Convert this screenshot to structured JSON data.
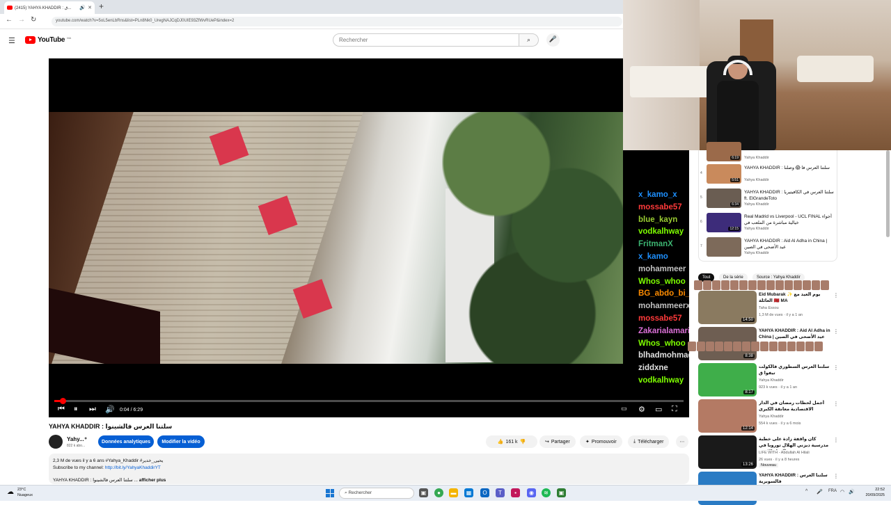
{
  "browser": {
    "tab_title": "(2415) YAHYA KHADDIR : ق...",
    "url": "youtube.com/watch?v=5oL5enLbRns&list=PLn8Nk0_UregNAJCqDJ0UIE93ZfWvRUeP&index=2"
  },
  "youtube": {
    "logo": "YouTube",
    "logo_country": "MA",
    "search_placeholder": "Rechercher"
  },
  "player": {
    "time_current": "0:04",
    "time_total": "6:29",
    "progress_fraction": 0.01
  },
  "chat": [
    {
      "user": "x_kamo_x",
      "color": "#1e90ff"
    },
    {
      "user": "mossabe57",
      "color": "#ff3a3a"
    },
    {
      "user": "blue_kayn",
      "color": "#9acd32"
    },
    {
      "user": "vodkalhway",
      "color": "#7fff00"
    },
    {
      "user": "FritmanX",
      "color": "#3cb371"
    },
    {
      "user": "x_kamo",
      "color": "#1e90ff"
    },
    {
      "user": "mohammeer",
      "color": "#c0c0c0"
    },
    {
      "user": "Whos_whoo",
      "color": "#7fff00"
    },
    {
      "user": "BG_abdo_bi_KD",
      "color": "#ff8c00"
    },
    {
      "user": "mohammeerx",
      "color": "#c0c0c0"
    },
    {
      "user": "mossabe57",
      "color": "#ff3a3a"
    },
    {
      "user": "Zakarialamari",
      "color": "#da70d6"
    },
    {
      "user": "Whos_whoo",
      "color": "#7fff00"
    },
    {
      "user": "blhadmohmad",
      "color": "#e0e0e0"
    },
    {
      "user": "ziddxne",
      "color": "#e0e0e0"
    },
    {
      "user": "vodkalhway",
      "color": "#7fff00"
    }
  ],
  "video": {
    "title": "YAHYA KHADDIR : سلتنا العرس فالشينوا",
    "channel_short": "Yahy...",
    "subscribers": "822 k abo...",
    "btn_analytics": "Données analytiques",
    "btn_edit": "Modifier la vidéo",
    "likes": "161 k",
    "share": "Partager",
    "promote": "Promouvoir",
    "download": "Télécharger",
    "desc_stats": "2,3 M de vues  il y a 6 ans  #Yahya_Khaddir #يحيى_خدير",
    "desc_subscribe": "Subscribe to my channel: ",
    "desc_link": "http://bit.ly/YahyaKhaddirYT",
    "desc_snippet": "YAHYA KHADDIR : سلتنا العرس فالشينوا ...",
    "desc_more": "afficher plus"
  },
  "playlist": [
    {
      "num": "",
      "title": "",
      "channel": "Yahya Khaddir",
      "duration": "6:19",
      "thumb": "#9b6a4a"
    },
    {
      "num": "4",
      "title": "YAHYA KHADDIR : سلتنا العرس فا 😱 وصلنا",
      "channel": "Yahya Khaddir",
      "duration": "5:51",
      "thumb": "#c98a5c"
    },
    {
      "num": "5",
      "title": "YAHYA KHADDIR : سلتنا العرس في الكافيتيريا ft. ElGrandeToto",
      "channel": "Yahya Khaddir",
      "duration": "6:34",
      "thumb": "#6a5d52"
    },
    {
      "num": "6",
      "title": "Real Madrid vs Liverpool - UCL FINAL أجواء خيالية مباشرة من الملعب في",
      "channel": "Yahya Khaddir",
      "duration": "12:15",
      "thumb": "#3d2c7a"
    },
    {
      "num": "7",
      "title": "YAHYA KHADDIR : Aid Al Adha in China | عيد الأضحى في الصين",
      "channel": "Yahya Khaddir",
      "duration": "",
      "thumb": "#7d6a5a"
    }
  ],
  "chips": [
    "Tout",
    "De la série",
    "Source : Yahya Khaddir"
  ],
  "recommendations": [
    {
      "title": "Eid Mubarak ✨ يوم العيد مع العائلة 🇲🇦 MA",
      "channel": "Taha Essou",
      "meta": "1,3 M de vues · il y a 1 an",
      "duration": "14:50",
      "thumb": "#8a7a60"
    },
    {
      "title": "YAHYA KHADDIR : Aid Al Adha in China | عيد الأضحى في الصين",
      "channel": "",
      "meta": "",
      "duration": "8:38",
      "thumb": "#6e5e52"
    },
    {
      "title": "سلتنا العرس السطوري فالكولت تيفوا ق",
      "channel": "Yahya Khaddir",
      "meta": "923 k vues · il y a 1 an",
      "duration": "8:17",
      "thumb": "#3fae4a"
    },
    {
      "title": "أجمل لحظات رمضان في الدار الاقتصادية معانقة الكبرى",
      "channel": "Yahya Khaddir",
      "meta": "554 k vues · il y a 6 mois",
      "duration": "12:14",
      "thumb": "#b47a64"
    },
    {
      "title": "كان واقفة زادة على خطبة مدرسية ديزني الهلال توروبا في هاد الاقمة 😱",
      "channel": "LIFE WITH - Abdullah Al Hilali",
      "meta": "26 vues · il y a 8 heures",
      "duration": "13:26",
      "thumb": "#1a1a1a",
      "badge": "Nouveau"
    },
    {
      "title": "YAHYA KHADDIR : سلتنا العرس فالسوبرية",
      "channel": "",
      "meta": "",
      "duration": "",
      "thumb": "#2a7bc4"
    }
  ],
  "taskbar": {
    "temp": "23°C",
    "weather": "Nuageux",
    "search": "Rechercher",
    "lang": "FRA",
    "time": "22:52",
    "date": "20/09/2025"
  }
}
